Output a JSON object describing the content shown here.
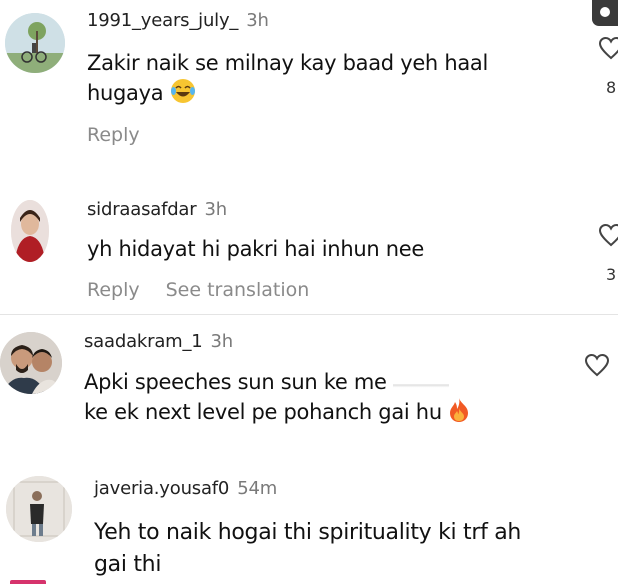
{
  "comments": [
    {
      "username": "1991_years_july_",
      "time": "3h",
      "text_line1": "Zakir naik se milnay kay baad yeh haal",
      "text_line2": "hugaya",
      "reply": "Reply",
      "likes": "8",
      "emoji_icon": "laughing-tears-emoji-icon"
    },
    {
      "username": "sidraasafdar",
      "time": "3h",
      "text": "yh hidayat hi pakri hai inhun nee",
      "reply": "Reply",
      "translate": "See translation",
      "likes": "3"
    },
    {
      "username": "saadakram_1",
      "time": "3h",
      "text_line1": "Apki speeches sun sun ke me",
      "text_line2": "ke ek next level pe pohanch gai hu",
      "emoji_icon": "fire-emoji-icon"
    },
    {
      "username": "javeria.yousaf0",
      "time": "54m",
      "text_line1": "Yeh to naik hogai thi spirituality ki trf ah",
      "text_line2": "gai thi"
    }
  ],
  "colors": {
    "background": "#ffffff",
    "text": "#111111",
    "muted": "#8a8a8a",
    "divider": "#e4e4e4"
  }
}
